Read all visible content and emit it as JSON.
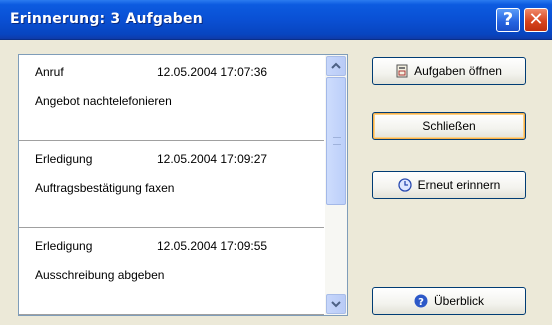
{
  "window": {
    "title": "Erinnerung: 3 Aufgaben"
  },
  "titlebar": {
    "help_glyph": "?",
    "close_glyph": "✕"
  },
  "reminders": [
    {
      "type": "Anruf",
      "datetime": "12.05.2004 17:07:36",
      "description": "Angebot nachtelefonieren"
    },
    {
      "type": "Erledigung",
      "datetime": "12.05.2004 17:09:27",
      "description": "Auftragsbestätigung faxen"
    },
    {
      "type": "Erledigung",
      "datetime": "12.05.2004 17:09:55",
      "description": "Ausschreibung abgeben"
    }
  ],
  "buttons": {
    "open_tasks": "Aufgaben öffnen",
    "close": "Schließen",
    "remind_again": "Erneut erinnern",
    "overview": "Überblick"
  },
  "icons": {
    "open_tasks": "task-document-icon",
    "remind_again": "clock-icon",
    "overview": "help-circle-icon"
  }
}
